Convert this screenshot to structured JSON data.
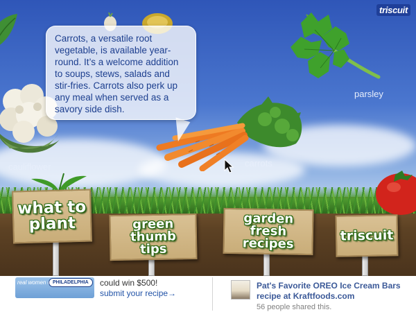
{
  "header": {
    "brand_logo": "triscuit"
  },
  "tooltip": {
    "text": "Carrots, a versatile root vegetable, is available year-round. It’s a welcome addition to soups, stews, salads and stir-fries. Carrots also perk up any meal when served as a savory side dish."
  },
  "vegetables": {
    "cauliflower": "cauliflower",
    "carrots": "carrots",
    "parsley": "parsley"
  },
  "nav_signs": [
    {
      "label": "what to\nplant"
    },
    {
      "label": "green thumb\ntips"
    },
    {
      "label": "garden fresh\nrecipes"
    },
    {
      "label": "triscuit"
    }
  ],
  "footer": {
    "promo": {
      "banner_left": "real women of",
      "banner_right": "PHILADELPHIA",
      "text": "could win $500!",
      "link": "submit your recipe→"
    },
    "social": {
      "title": "Pat's Favorite OREO Ice Cream Bars recipe at Kraftfoods.com",
      "count": "56 people shared this."
    }
  },
  "colors": {
    "sky_top": "#2f56b8",
    "sign_text_outline": "#2a6a14",
    "link": "#2253a7",
    "fb_blue": "#3b5998"
  }
}
